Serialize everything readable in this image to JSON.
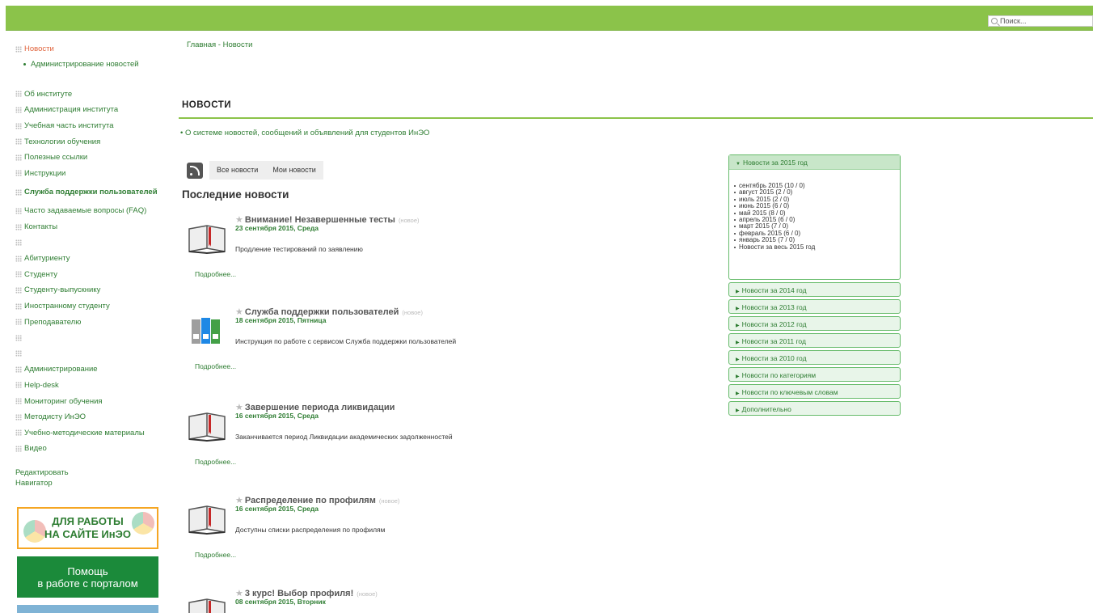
{
  "search": {
    "placeholder": "Поиск..."
  },
  "sidebar": {
    "news": "Новости",
    "news_admin": "Администрирование новостей",
    "items": [
      {
        "label": "Об институте"
      },
      {
        "label": "Администрация института"
      },
      {
        "label": "Учебная часть института"
      },
      {
        "label": "Технологии обучения"
      },
      {
        "label": "Полезные ссылки"
      },
      {
        "label": "Инструкции"
      },
      {
        "label": "Служба поддержки пользователей"
      },
      {
        "label": "Часто задаваемые вопросы (FAQ)"
      },
      {
        "label": "Контакты"
      },
      {
        "label": ""
      },
      {
        "label": "Абитуриенту"
      },
      {
        "label": "Студенту"
      },
      {
        "label": "Студенту-выпускнику"
      },
      {
        "label": "Иностранному студенту"
      },
      {
        "label": "Преподавателю"
      },
      {
        "label": ""
      },
      {
        "label": ""
      },
      {
        "label": "Администрирование"
      },
      {
        "label": "Help-desk"
      },
      {
        "label": "Мониторинг обучения"
      },
      {
        "label": "Методисту ИнЭО"
      },
      {
        "label": "Учебно-методические материалы"
      },
      {
        "label": "Видео"
      }
    ],
    "edit": "Редактировать",
    "navigator": "Навигатор",
    "banner1": "ДЛЯ РАБОТЫ НА САЙТЕ ИнЭО",
    "banner2_line1": "Помощь",
    "banner2_line2": "в работе с порталом"
  },
  "breadcrumb": "Главная - Новости",
  "page_title": "НОВОСТИ",
  "intro_link": "• О системе новостей, сообщений и объявлений для студентов ИнЭО",
  "tabs": {
    "all": "Все новости",
    "mine": "Мои новости"
  },
  "latest_heading": "Последние новости",
  "news": [
    {
      "title": "Внимание! Незавершенные тесты",
      "new": "(новое)",
      "date": "23 сентября 2015, Среда",
      "text": "Продление тестирований по заявлению",
      "more": "Подробнее...",
      "icon": "book-icon"
    },
    {
      "title": "Служба поддержки пользователей",
      "new": "(новое)",
      "date": "18 сентября 2015, Пятница",
      "text": "Инструкция по работе с сервисом Служба поддержки пользователей",
      "more": "Подробнее...",
      "icon": "binders-icon"
    },
    {
      "title": "Завершение периода ликвидации",
      "new": "",
      "date": "16 сентября 2015, Среда",
      "text": "Заканчивается период Ликвидации академических задолженностей",
      "more": "Подробнее...",
      "icon": "book-icon"
    },
    {
      "title": "Распределение по профилям",
      "new": "(новое)",
      "date": "16 сентября 2015, Среда",
      "text": "Доступны списки распределения по профилям",
      "more": "Подробнее...",
      "icon": "book-icon"
    },
    {
      "title": "3 курс! Выбор профиля!",
      "new": "(новое)",
      "date": "08 сентября 2015, Вторник",
      "text": "",
      "more": "",
      "icon": "book-icon"
    }
  ],
  "archive": {
    "open_head": "Новости за 2015 год",
    "months": [
      "сентябрь 2015 (10 / 0)",
      "август 2015 (2 / 0)",
      "июль 2015 (2 / 0)",
      "июнь 2015 (6 / 0)",
      "май 2015 (8 / 0)",
      "апрель 2015 (6 / 0)",
      "март 2015 (7 / 0)",
      "февраль 2015 (6 / 0)",
      "январь 2015 (7 / 0)",
      "Новости за весь 2015 год"
    ],
    "closed": [
      "Новости за 2014 год",
      "Новости за 2013 год",
      "Новости за 2012 год",
      "Новости за 2011 год",
      "Новости за 2010 год",
      "Новости по категориям",
      "Новости по ключевым словам",
      "Дополнительно"
    ]
  },
  "colors": {
    "accent": "#8bc34a",
    "link": "#2e7d32",
    "active": "#e0633c"
  }
}
